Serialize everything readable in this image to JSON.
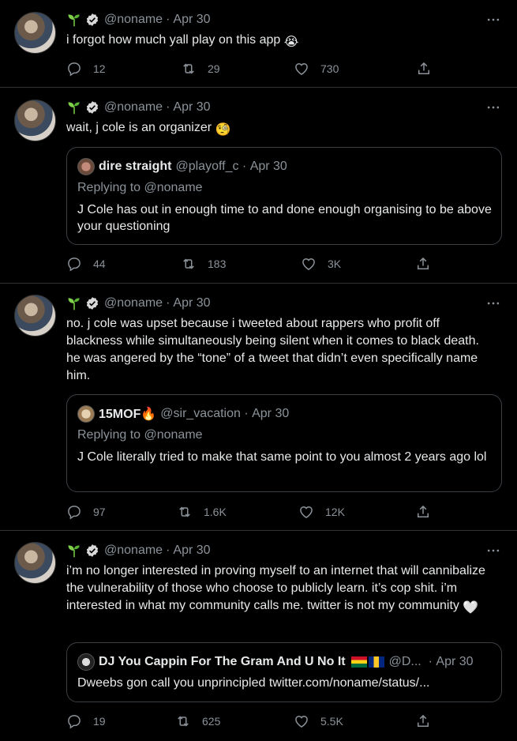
{
  "tweets": [
    {
      "handle": "@noname",
      "date": "Apr 30",
      "text": "i forgot how much yall play on this app",
      "emoji": "😭",
      "replies": "12",
      "retweets": "29",
      "likes": "730"
    },
    {
      "handle": "@noname",
      "date": "Apr 30",
      "text": "wait, j cole is an organizer",
      "emoji": "🧐",
      "quote": {
        "name": "dire straight",
        "handle": "@playoff_c",
        "date": "Apr 30",
        "replying": "Replying to @noname",
        "text": "J Cole has out in enough time to and done enough organising to be above your questioning"
      },
      "replies": "44",
      "retweets": "183",
      "likes": "3K"
    },
    {
      "handle": "@noname",
      "date": "Apr 30",
      "text": "no. j cole was upset because i tweeted about rappers who profit off blackness while simultaneously being silent when it comes to black death. he was angered by the “tone” of a tweet that didn’t even specifically name him.",
      "quote": {
        "name": "15MOF",
        "name_emoji": "🔥",
        "handle": "@sir_vacation",
        "date": "Apr 30",
        "replying": "Replying to @noname",
        "text": "J Cole literally tried to make that same point to you almost 2 years ago lol"
      },
      "replies": "97",
      "retweets": "1.6K",
      "likes": "12K"
    },
    {
      "handle": "@noname",
      "date": "Apr 30",
      "text": "i’m no longer interested in proving myself to an internet that will cannibalize the vulnerability of those who choose to publicly learn. it’s cop shit. i’m interested in what my community calls me. twitter is not my community",
      "emoji": "🤍",
      "quote": {
        "name": "DJ You Cappin For The Gram And U No It",
        "handle": "@D...",
        "date": "Apr 30",
        "text": "Dweebs gon call you unprincipled twitter.com/noname/status/..."
      },
      "replies": "19",
      "retweets": "625",
      "likes": "5.5K"
    }
  ],
  "icons": {
    "reply": "reply-icon",
    "retweet": "retweet-icon",
    "like": "like-icon",
    "share": "share-icon",
    "more": "more-icon",
    "sprout": "sprout-icon",
    "verified": "verified-badge-icon"
  },
  "colors": {
    "background": "#000000",
    "muted": "#8b9299",
    "text": "#e7e9ea",
    "border": "#2f3336"
  }
}
